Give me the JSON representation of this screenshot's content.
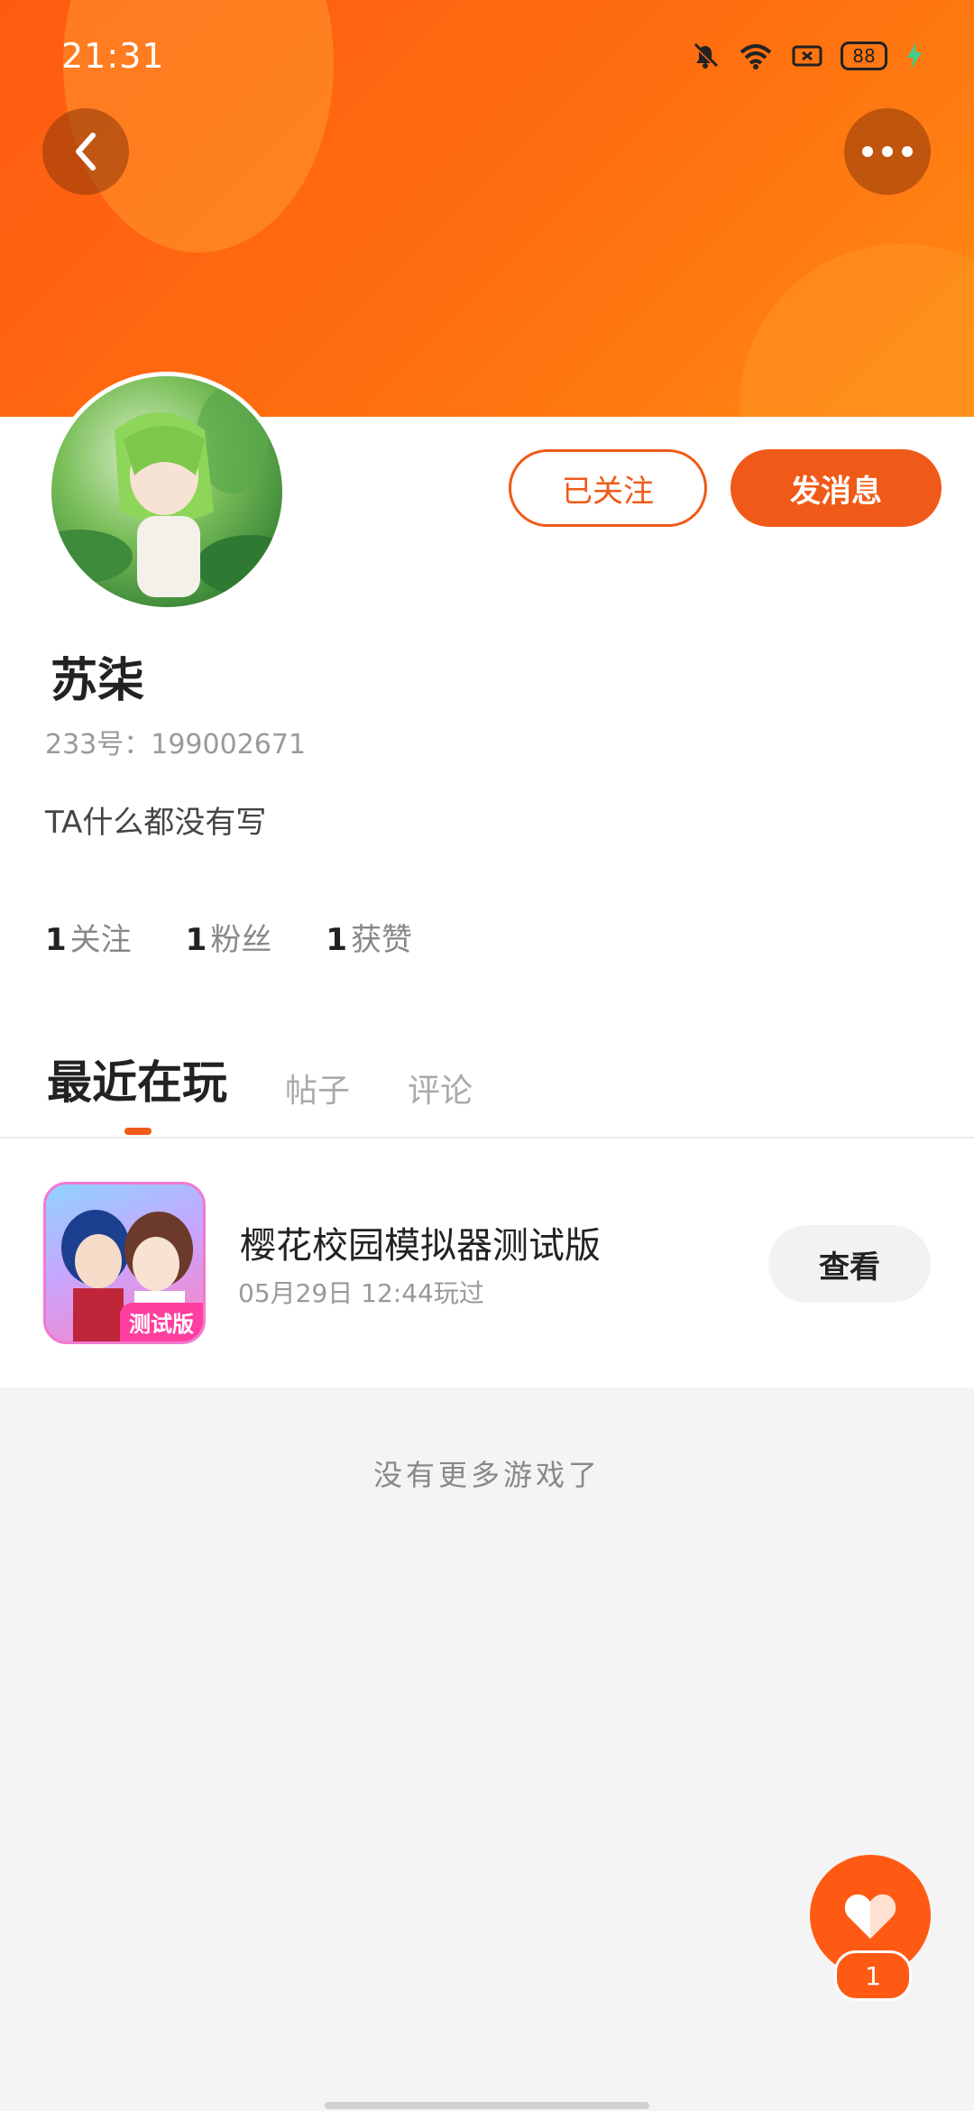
{
  "status_bar": {
    "time": "21:31",
    "battery": "88"
  },
  "profile": {
    "name": "苏柒",
    "id_text": "233号：199002671",
    "bio": "TA什么都没有写",
    "follow_button": "已关注",
    "message_button": "发消息",
    "stats": [
      {
        "num": "1",
        "label": "关注"
      },
      {
        "num": "1",
        "label": "粉丝"
      },
      {
        "num": "1",
        "label": "获赞"
      }
    ]
  },
  "tabs": [
    {
      "label": "最近在玩",
      "active": true
    },
    {
      "label": "帖子"
    },
    {
      "label": "评论"
    }
  ],
  "game": {
    "title": "樱花校园模拟器测试版",
    "played": "05月29日 12:44玩过",
    "icon_badge": "测试版",
    "view_button": "查看"
  },
  "footer_text": "没有更多游戏了",
  "like": {
    "count": "1"
  },
  "colors": {
    "accent": "#f05a18",
    "header": "#ff6a10"
  },
  "icons": [
    "back-arrow-icon",
    "more-dots-icon",
    "bell-muted-icon",
    "wifi-icon",
    "sim-icon",
    "battery-icon",
    "charging-bolt-icon",
    "heart-icon"
  ]
}
